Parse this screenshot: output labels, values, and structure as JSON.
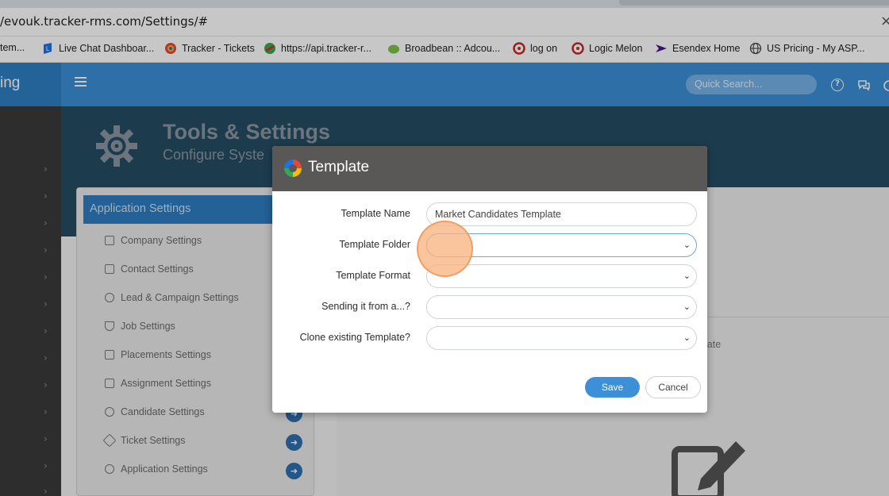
{
  "browser": {
    "url": "/evouk.tracker-rms.com/Settings/#",
    "bookmarks": [
      {
        "label": "tem...",
        "icon": "none",
        "color": ""
      },
      {
        "label": "Live Chat Dashboar...",
        "icon": "live-chat-icon",
        "color": "#1a73e8"
      },
      {
        "label": "Tracker - Tickets",
        "icon": "tracker-logo-icon",
        "color": "#e8453c"
      },
      {
        "label": "https://api.tracker-r...",
        "icon": "api-logo-icon",
        "color": "#d93025"
      },
      {
        "label": "Broadbean :: Adcou...",
        "icon": "broadbean-icon",
        "color": "#7cc24a"
      },
      {
        "label": "log on",
        "icon": "logon-icon",
        "color": "#c62828"
      },
      {
        "label": "Logic Melon",
        "icon": "logic-melon-icon",
        "color": "#c62828"
      },
      {
        "label": "Esendex Home",
        "icon": "esendex-icon",
        "color": "#4a148c"
      },
      {
        "label": "US Pricing - My ASP...",
        "icon": "globe-icon",
        "color": "#555555"
      }
    ]
  },
  "topbar": {
    "brand": "ing",
    "search_placeholder": "Quick Search..."
  },
  "banner": {
    "title": "Tools & Settings",
    "subtitle": "Configure Syste"
  },
  "settings": {
    "header": "Application Settings",
    "items": [
      {
        "label": "Company Settings"
      },
      {
        "label": "Contact Settings"
      },
      {
        "label": "Lead & Campaign Settings"
      },
      {
        "label": "Job Settings"
      },
      {
        "label": "Placements Settings"
      },
      {
        "label": "Assignment Settings"
      },
      {
        "label": "Candidate Settings"
      },
      {
        "label": "Ticket Settings"
      },
      {
        "label": "Application Settings"
      }
    ]
  },
  "content": {
    "partial_text": "late"
  },
  "modal": {
    "title": "Template",
    "fields": [
      {
        "label": "Template Name",
        "value": "Market Candidates Template",
        "type": "text"
      },
      {
        "label": "Template Folder",
        "value": "",
        "type": "select"
      },
      {
        "label": "Template Format",
        "value": "",
        "type": "select"
      },
      {
        "label": "Sending it from a...?",
        "value": "",
        "type": "select"
      },
      {
        "label": "Clone existing Template?",
        "value": "",
        "type": "select"
      }
    ],
    "save_label": "Save",
    "cancel_label": "Cancel"
  },
  "colors": {
    "accent": "#3b8fd6",
    "modal_header": "#5a5856",
    "click_marker": "#f8b482"
  }
}
